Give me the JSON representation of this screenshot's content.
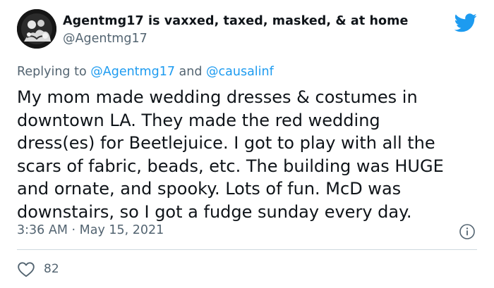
{
  "author": {
    "display_name": "Agentmg17 is vaxxed, taxed, masked, & at home",
    "handle": "@Agentmg17",
    "avatar_icon": "profile-photo-icon"
  },
  "brand_icon": "twitter-bird-icon",
  "reply": {
    "prefix": "Replying to ",
    "mention_1": "@Agentmg17",
    "conjunction": " and ",
    "mention_2": "@causalinf"
  },
  "tweet": {
    "lines": [
      "My mom made wedding dresses & costumes in",
      "downtown LA. They made the red wedding",
      "dress(es) for Beetlejuice. I got to play with all the",
      "scars of fabric, beads, etc. The building was HUGE",
      "and ornate, and spooky. Lots of fun. McD was",
      "downstairs, so I got a fudge sunday every day."
    ]
  },
  "meta": {
    "timestamp": "3:36 AM · May 15, 2021",
    "info_icon": "info-icon"
  },
  "actions": {
    "like_icon": "heart-icon",
    "like_count": "82"
  },
  "colors": {
    "text": "#0f1419",
    "secondary": "#536471",
    "accent": "#1d9bf0",
    "divider": "#cfd9de"
  }
}
